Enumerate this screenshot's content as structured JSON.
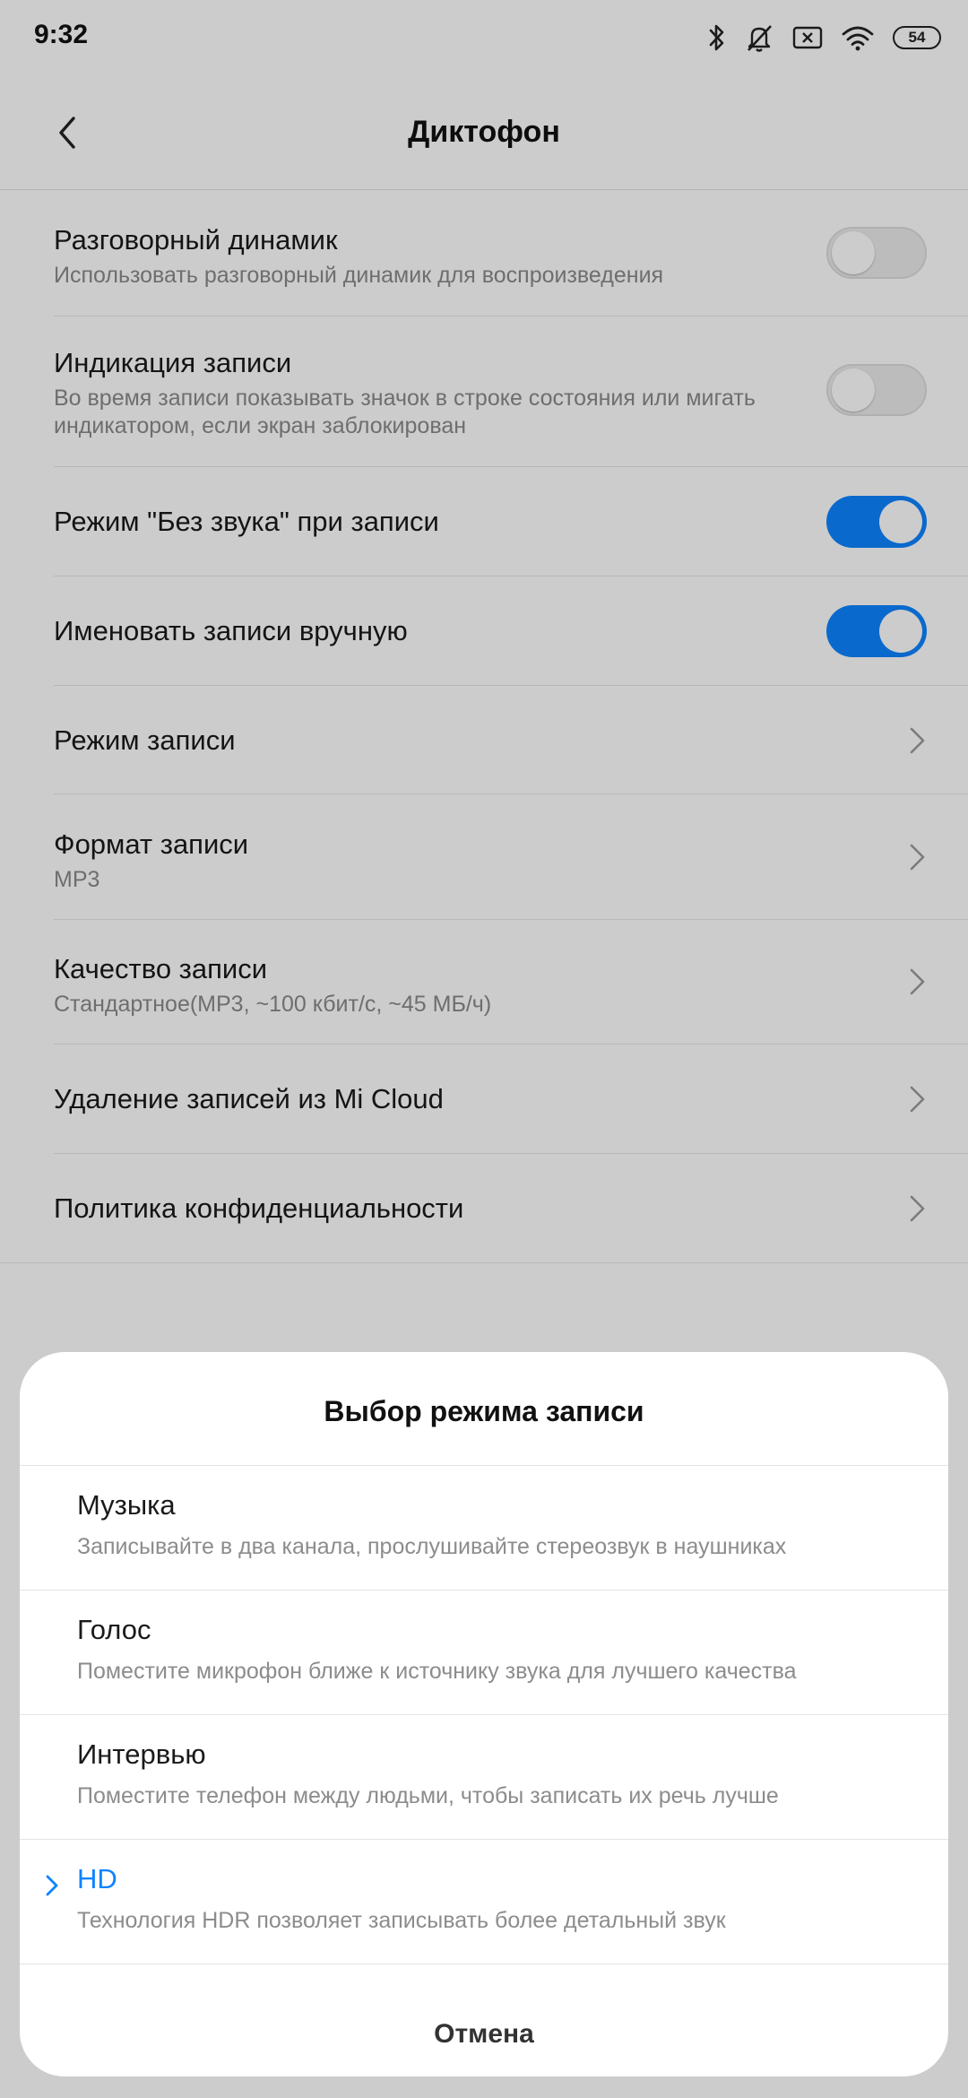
{
  "status_bar": {
    "time": "9:32",
    "battery": "54",
    "icons": [
      "bluetooth-icon",
      "silent-icon",
      "sim-missing-icon",
      "wifi-icon",
      "battery-icon"
    ]
  },
  "header": {
    "title": "Диктофон"
  },
  "settings": [
    {
      "title": "Разговорный динамик",
      "subtitle": "Использовать разговорный динамик для воспроизведения",
      "control": "toggle",
      "on": false
    },
    {
      "title": "Индикация записи",
      "subtitle": "Во время записи показывать значок в строке состояния или мигать индикатором, если экран заблокирован",
      "control": "toggle",
      "on": false
    },
    {
      "title": "Режим \"Без звука\" при записи",
      "control": "toggle",
      "on": true
    },
    {
      "title": "Именовать записи вручную",
      "control": "toggle",
      "on": true
    },
    {
      "title": "Режим записи",
      "control": "chevron"
    },
    {
      "title": "Формат записи",
      "subtitle": "MP3",
      "control": "chevron"
    },
    {
      "title": "Качество записи",
      "subtitle": "Стандартное(MP3, ~100 кбит/с, ~45 МБ/ч)",
      "control": "chevron"
    },
    {
      "title": "Удаление записей из Mi Cloud",
      "control": "chevron"
    },
    {
      "title": "Политика конфиденциальности",
      "control": "chevron"
    }
  ],
  "sheet": {
    "title": "Выбор режима записи",
    "options": [
      {
        "title": "Музыка",
        "subtitle": "Записывайте в два канала, прослушивайте стереозвук в наушниках",
        "selected": false
      },
      {
        "title": "Голос",
        "subtitle": "Поместите микрофон ближе к источнику звука для лучшего качества",
        "selected": false
      },
      {
        "title": "Интервью",
        "subtitle": "Поместите телефон между людьми, чтобы записать их речь лучше",
        "selected": false
      },
      {
        "title": "HD",
        "subtitle": "Технология HDR позволяет записывать более детальный звук",
        "selected": true
      }
    ],
    "cancel_label": "Отмена"
  },
  "colors": {
    "accent": "#0d84ff",
    "toggle_off": "#ececec",
    "scrim": "rgba(0,0,0,0.2)"
  }
}
